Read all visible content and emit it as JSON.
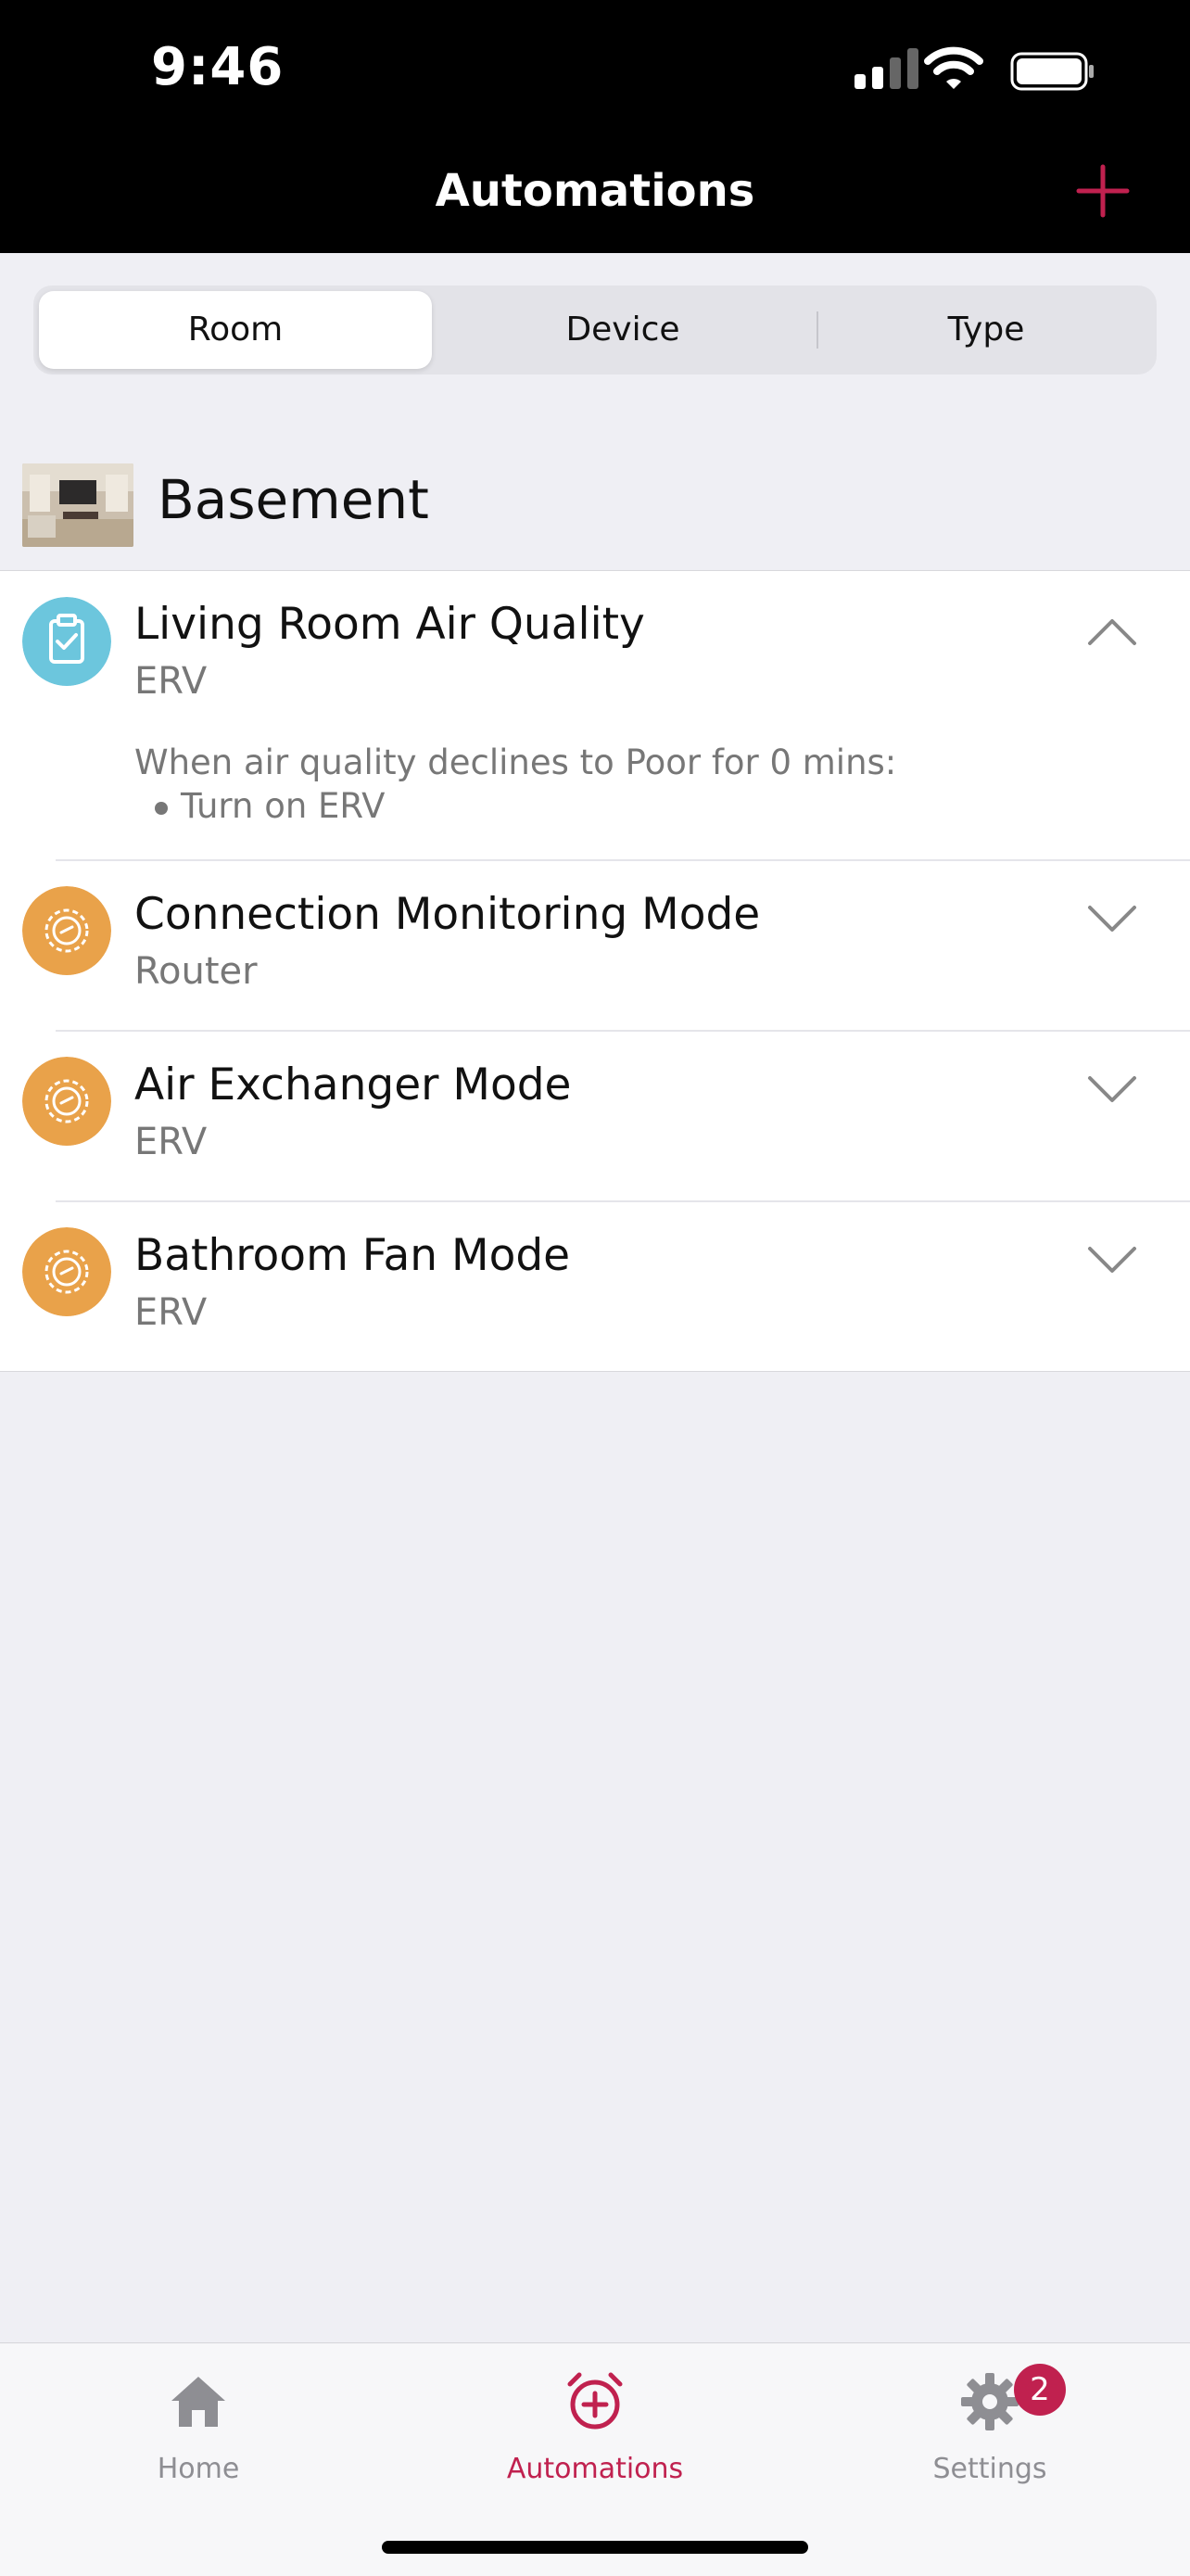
{
  "status_bar": {
    "time": "9:46"
  },
  "header": {
    "title": "Automations",
    "add_icon": "plus-icon"
  },
  "segments": [
    {
      "label": "Room",
      "active": true
    },
    {
      "label": "Device",
      "active": false
    },
    {
      "label": "Type",
      "active": false
    }
  ],
  "room": {
    "name": "Basement"
  },
  "automations": [
    {
      "name": "Living Room Air Quality",
      "device": "ERV",
      "icon": "clipboard-check-icon",
      "color": "#6cc6dd",
      "expanded": true,
      "detail": {
        "condition": "When air quality declines to Poor for 0 mins:",
        "actions": [
          "Turn on ERV"
        ]
      }
    },
    {
      "name": "Connection Monitoring Mode",
      "device": "Router",
      "icon": "gear-icon",
      "color": "#e9a24a",
      "expanded": false
    },
    {
      "name": "Air Exchanger Mode",
      "device": "ERV",
      "icon": "gear-icon",
      "color": "#e9a24a",
      "expanded": false
    },
    {
      "name": "Bathroom Fan Mode",
      "device": "ERV",
      "icon": "gear-icon",
      "color": "#e9a24a",
      "expanded": false
    }
  ],
  "tabbar": {
    "home": {
      "label": "Home",
      "icon": "house-icon"
    },
    "automations": {
      "label": "Automations",
      "icon": "alarm-plus-icon",
      "active": true
    },
    "settings": {
      "label": "Settings",
      "icon": "gear-icon",
      "badge": "2"
    }
  },
  "colors": {
    "accent": "#c0214f",
    "automation_blue": "#6cc6dd",
    "automation_orange": "#e9a24a"
  }
}
